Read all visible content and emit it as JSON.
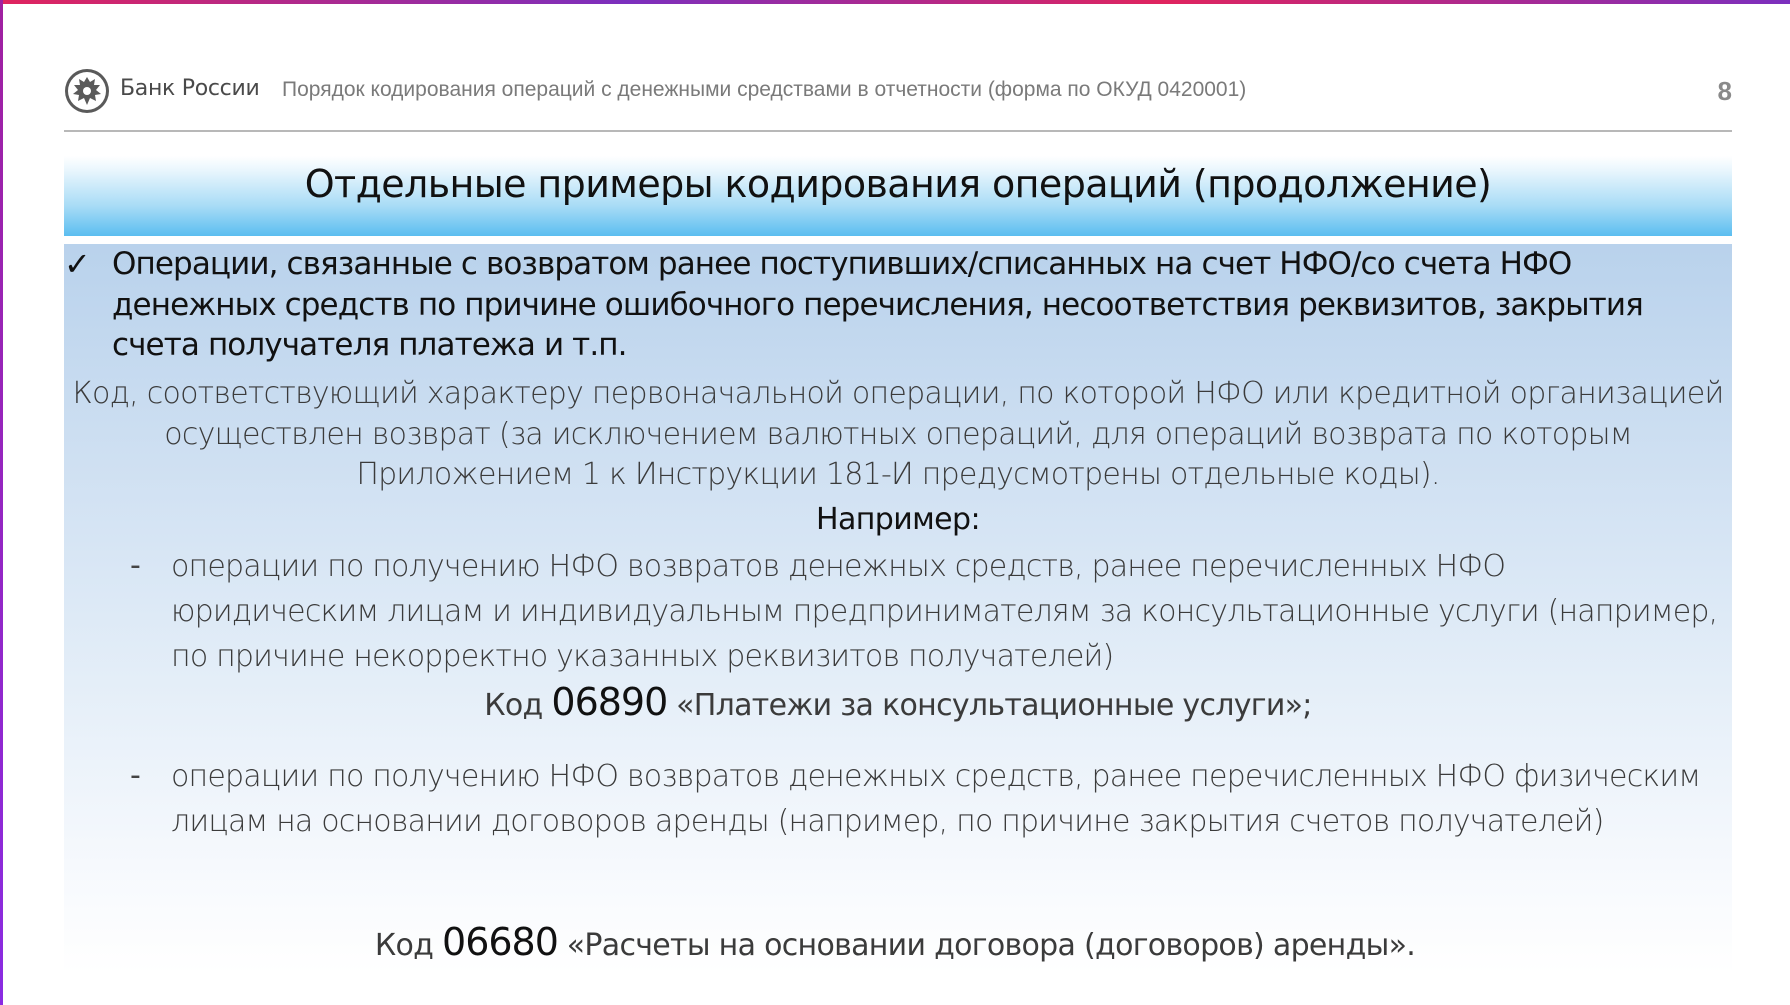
{
  "header": {
    "bank_name": "Банк России",
    "title": "Порядок кодирования операций с денежными средствами в отчетности (форма по ОКУД 0420001)",
    "page_number": "8"
  },
  "slide_title": "Отдельные примеры кодирования операций (продолжение)",
  "bullet": {
    "text": "Операции, связанные с возвратом ранее поступивших/списанных на счет НФО/со счета НФО денежных средств по причине ошибочного перечисления, несоответствия реквизитов, закрытия счета получателя платежа и т.п."
  },
  "lead_paragraph": "Код, соответствующий характеру первоначальной операции, по которой НФО или кредитной организацией осуществлен возврат (за исключением валютных операций, для операций возврата по которым Приложением 1 к Инструкции 181-И предусмотрены отдельные коды).",
  "example_label": "Например:",
  "items": [
    {
      "dash": "-",
      "text": "операции по получению НФО возвратов денежных средств, ранее перечисленных НФО юридическим лицам и индивидуальным предпринимателям за консультационные услуги (например, по причине некорректно указанных реквизитов получателей)",
      "code_prefix": "Код",
      "code": "06890",
      "code_desc": "«Платежи за консультационные услуги»;"
    },
    {
      "dash": "-",
      "text": "операции по получению НФО возвратов денежных средств, ранее перечисленных НФО физическим лицам на основании договоров аренды (например, по причине закрытия счетов получателей)",
      "code_prefix": "Код",
      "code": "06680",
      "code_desc": "«Расчеты на основании договора (договоров) аренды»."
    }
  ],
  "icons": {
    "logo": "bank-of-russia-eagle-icon",
    "bullet": "checkmark-icon"
  },
  "colors": {
    "title_band_accent": "#5bbef0",
    "content_panel": "#cfe0f2",
    "top_line": "#e0245e"
  }
}
